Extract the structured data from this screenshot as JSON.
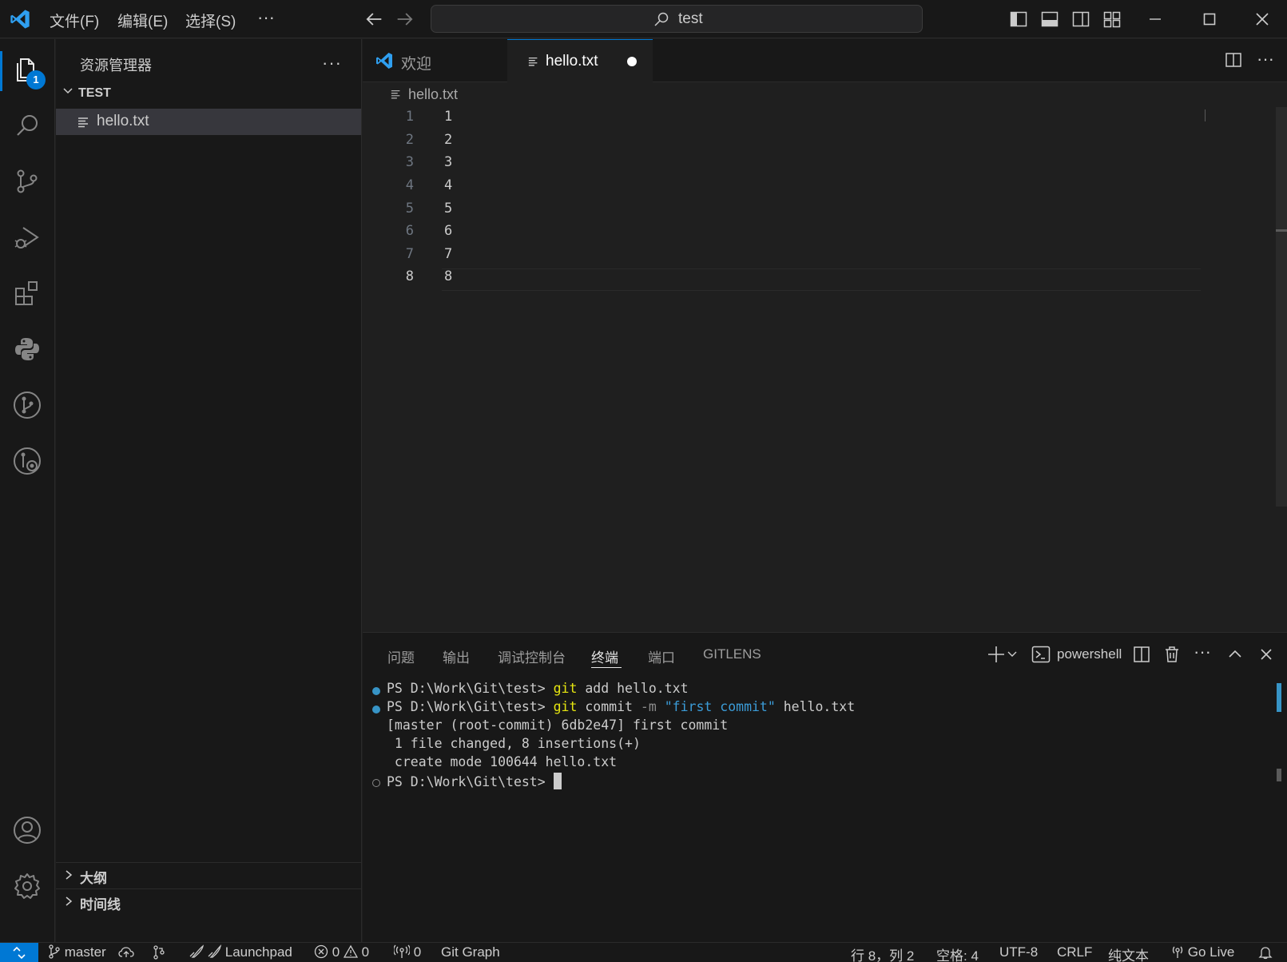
{
  "titlebar": {
    "menus": [
      "文件(F)",
      "编辑(E)",
      "选择(S)",
      "···"
    ],
    "search_text": "test"
  },
  "activity": {
    "explorer_badge": "1"
  },
  "sidebar": {
    "title": "资源管理器",
    "more": "···",
    "section": "TEST",
    "file": "hello.txt",
    "outline": "大纲",
    "timeline": "时间线"
  },
  "tabs": [
    {
      "label": "欢迎"
    },
    {
      "label": "hello.txt"
    }
  ],
  "breadcrumb": "hello.txt",
  "editor": {
    "line_numbers": [
      "1",
      "2",
      "3",
      "4",
      "5",
      "6",
      "7",
      "8"
    ],
    "lines": [
      "1",
      "2",
      "3",
      "4",
      "5",
      "6",
      "7",
      "8"
    ],
    "current_line": 8
  },
  "panel": {
    "tabs": [
      "问题",
      "输出",
      "调试控制台",
      "终端",
      "端口",
      "GITLENS"
    ],
    "active_tab": "终端",
    "shell": "powershell",
    "terminal": {
      "prompt": "PS D:\\Work\\Git\\test> ",
      "cmd1_kw": "git",
      "cmd1_rest": " add hello.txt",
      "cmd2_kw": "git",
      "cmd2_mid": " commit ",
      "cmd2_flag": "-m",
      "cmd2_str": " \"first commit\"",
      "cmd2_rest": " hello.txt",
      "out1": "[master (root-commit) 6db2e47] first commit",
      "out2": " 1 file changed, 8 insertions(+)",
      "out3": " create mode 100644 hello.txt"
    }
  },
  "statusbar": {
    "branch": "master",
    "launchpad": "Launchpad",
    "errors": "0",
    "warnings": "0",
    "ports": "0",
    "git_graph": "Git Graph",
    "position": "行 8，列 2",
    "spaces": "空格: 4",
    "encoding": "UTF-8",
    "eol": "CRLF",
    "language": "纯文本",
    "golive": "Go Live"
  },
  "colors": {
    "accent": "#0078d4",
    "editor_bg": "#1f1f1f",
    "chrome_bg": "#181818"
  }
}
